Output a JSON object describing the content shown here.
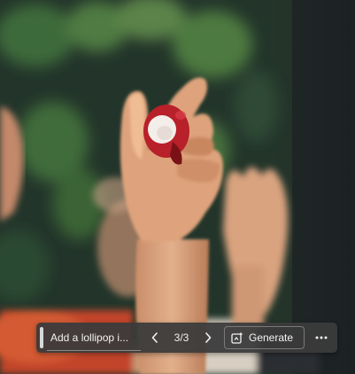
{
  "photo": {
    "icon": "photo-of-raised-hands-holding-fruit"
  },
  "toolbar": {
    "prompt_value": "Add a lollipop i...",
    "counter": "3/3",
    "generate_label": "Generate",
    "icons": {
      "prev": "chevron-left-icon",
      "next": "chevron-right-icon",
      "generate": "generate-sparkle-icon",
      "more": "more-horizontal-icon"
    }
  },
  "colors": {
    "toolbar_bg": "#3a3a3a",
    "text": "#f2f2f2",
    "fruit_red": "#b8202a"
  }
}
